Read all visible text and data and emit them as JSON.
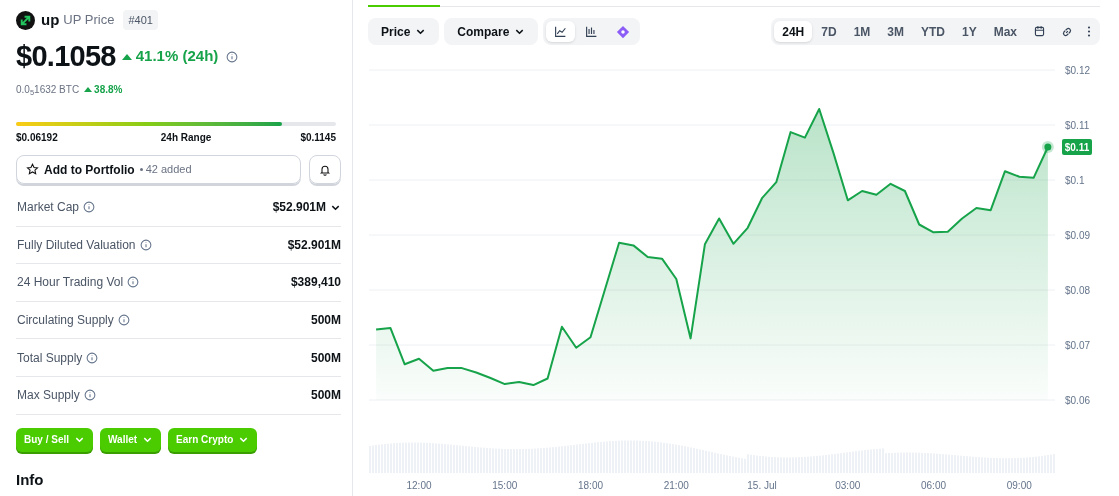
{
  "coin": {
    "symbol": "up",
    "name": "UP Price",
    "rank": "#401"
  },
  "price": {
    "value": "$0.1058",
    "change": "41.1% (24h)",
    "btc": "0.0$_{5}$1632 BTC",
    "btc_change": "38.8%"
  },
  "range": {
    "low": "$0.06192",
    "label": "24h Range",
    "high": "$0.1145",
    "level": 0.83
  },
  "portfolio": {
    "label": "Add to Portfolio",
    "count": "42 added"
  },
  "stats": [
    {
      "label": "Market Cap",
      "value": "$52.901M",
      "expandable": true
    },
    {
      "label": "Fully Diluted Valuation",
      "value": "$52.901M",
      "expandable": false
    },
    {
      "label": "24 Hour Trading Vol",
      "value": "$389,410",
      "expandable": false
    },
    {
      "label": "Circulating Supply",
      "value": "500M",
      "expandable": false
    },
    {
      "label": "Total Supply",
      "value": "500M",
      "expandable": false
    },
    {
      "label": "Max Supply",
      "value": "500M",
      "expandable": false
    }
  ],
  "action_buttons": [
    "Buy / Sell",
    "Wallet",
    "Earn Crypto"
  ],
  "section_heading": "Info",
  "chart_toolbar": {
    "selectors": [
      "Price",
      "Compare"
    ],
    "chart_types": [
      {
        "kind": "line",
        "selected": true
      },
      {
        "kind": "candles",
        "selected": false
      },
      {
        "kind": "diamond",
        "selected": false
      }
    ],
    "ranges": [
      {
        "label": "24H",
        "selected": true
      },
      {
        "label": "7D",
        "selected": false
      },
      {
        "label": "1M",
        "selected": false
      },
      {
        "label": "3M",
        "selected": false
      },
      {
        "label": "YTD",
        "selected": false
      },
      {
        "label": "1Y",
        "selected": false
      },
      {
        "label": "Max",
        "selected": false
      }
    ]
  },
  "chart": {
    "chart_data": {
      "type": "area",
      "ylim": [
        0.06,
        0.12
      ],
      "categories": [
        null,
        null,
        null,
        "12:00",
        null,
        null,
        null,
        null,
        null,
        "15:00",
        null,
        null,
        null,
        null,
        null,
        "18:00",
        null,
        null,
        null,
        null,
        null,
        "21:00",
        null,
        null,
        null,
        null,
        null,
        "15. Jul",
        null,
        null,
        null,
        null,
        null,
        "03:00",
        null,
        null,
        null,
        null,
        null,
        "06:00",
        null,
        null,
        null,
        null,
        null,
        "09:00",
        null,
        null
      ],
      "yticks": [
        {
          "value": 0.12,
          "label": "$0.12"
        },
        {
          "value": 0.11,
          "label": "$0.11"
        },
        {
          "value": 0.1,
          "label": "$0.1"
        },
        {
          "value": 0.09,
          "label": "$0.09"
        },
        {
          "value": 0.08,
          "label": "$0.08"
        },
        {
          "value": 0.07,
          "label": "$0.07"
        },
        {
          "value": 0.06,
          "label": "$0.06"
        }
      ],
      "series": [
        {
          "color": "#16a34a",
          "values": [
            0.0728,
            0.0731,
            0.0665,
            0.0675,
            0.0653,
            0.0658,
            0.0658,
            0.065,
            0.064,
            0.0629,
            0.0633,
            0.0627,
            0.0639,
            0.0733,
            0.0695,
            0.0714,
            0.08,
            0.0886,
            0.0881,
            0.086,
            0.0857,
            0.082,
            0.0712,
            0.0883,
            0.093,
            0.0884,
            0.0913,
            0.0967,
            0.0996,
            0.1087,
            0.1077,
            0.1129,
            0.1049,
            0.0963,
            0.098,
            0.0973,
            0.0993,
            0.098,
            0.0919,
            0.0905,
            0.0906,
            0.093,
            0.0949,
            0.0945,
            0.1016,
            0.1006,
            0.1004,
            0.106
          ]
        }
      ],
      "grid": true,
      "annotations": [
        "$0.11"
      ]
    }
  }
}
